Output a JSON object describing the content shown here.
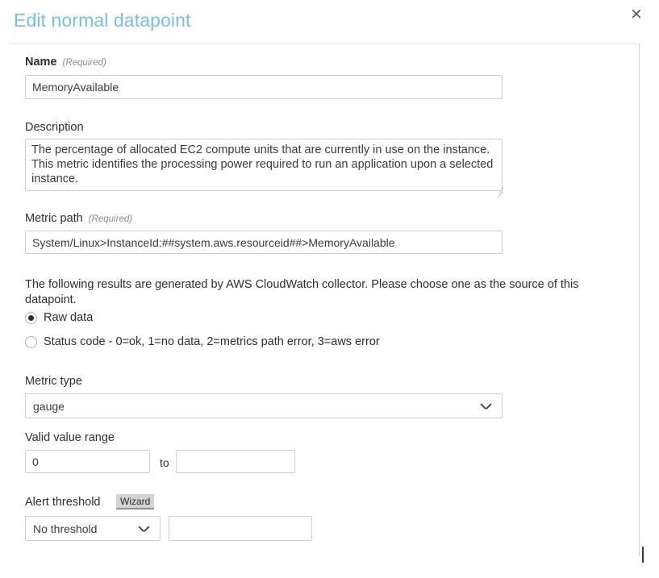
{
  "dialog": {
    "title": "Edit normal datapoint",
    "close_label": "×"
  },
  "form": {
    "name": {
      "label": "Name",
      "required_note": "(Required)",
      "value": "MemoryAvailable",
      "placeholder": ""
    },
    "description": {
      "label": "Description",
      "value": "The percentage of allocated EC2 compute units that are currently in use on the instance. This metric identifies the processing power required to run an application upon a selected instance.",
      "placeholder": ""
    },
    "metric_path": {
      "label": "Metric path",
      "required_note": "(Required)",
      "value": "System/Linux>InstanceId:##system.aws.resourceid##>MemoryAvailable",
      "placeholder": ""
    },
    "source": {
      "helper_text": "The following results are generated by AWS CloudWatch collector. Please choose one as the source of this datapoint.",
      "options": [
        {
          "label": "Raw data",
          "selected": true
        },
        {
          "label": "Status code - 0=ok, 1=no data, 2=metrics path error, 3=aws error",
          "selected": false
        }
      ]
    },
    "metric_type": {
      "label": "Metric type",
      "value": "gauge"
    },
    "valid_value_range": {
      "label": "Valid value range",
      "min_value": "0",
      "separator": "to",
      "max_value": "",
      "min_placeholder": "",
      "max_placeholder": ""
    },
    "alert_threshold": {
      "label": "Alert threshold",
      "wizard_label": "Wizard",
      "select_value": "No threshold",
      "expression_value": "",
      "expression_placeholder": ""
    }
  },
  "colors": {
    "title": "#74c0e3",
    "border": "#cfcfcf",
    "text": "#2e2e2e",
    "badge_bg": "#d3d3d3"
  }
}
